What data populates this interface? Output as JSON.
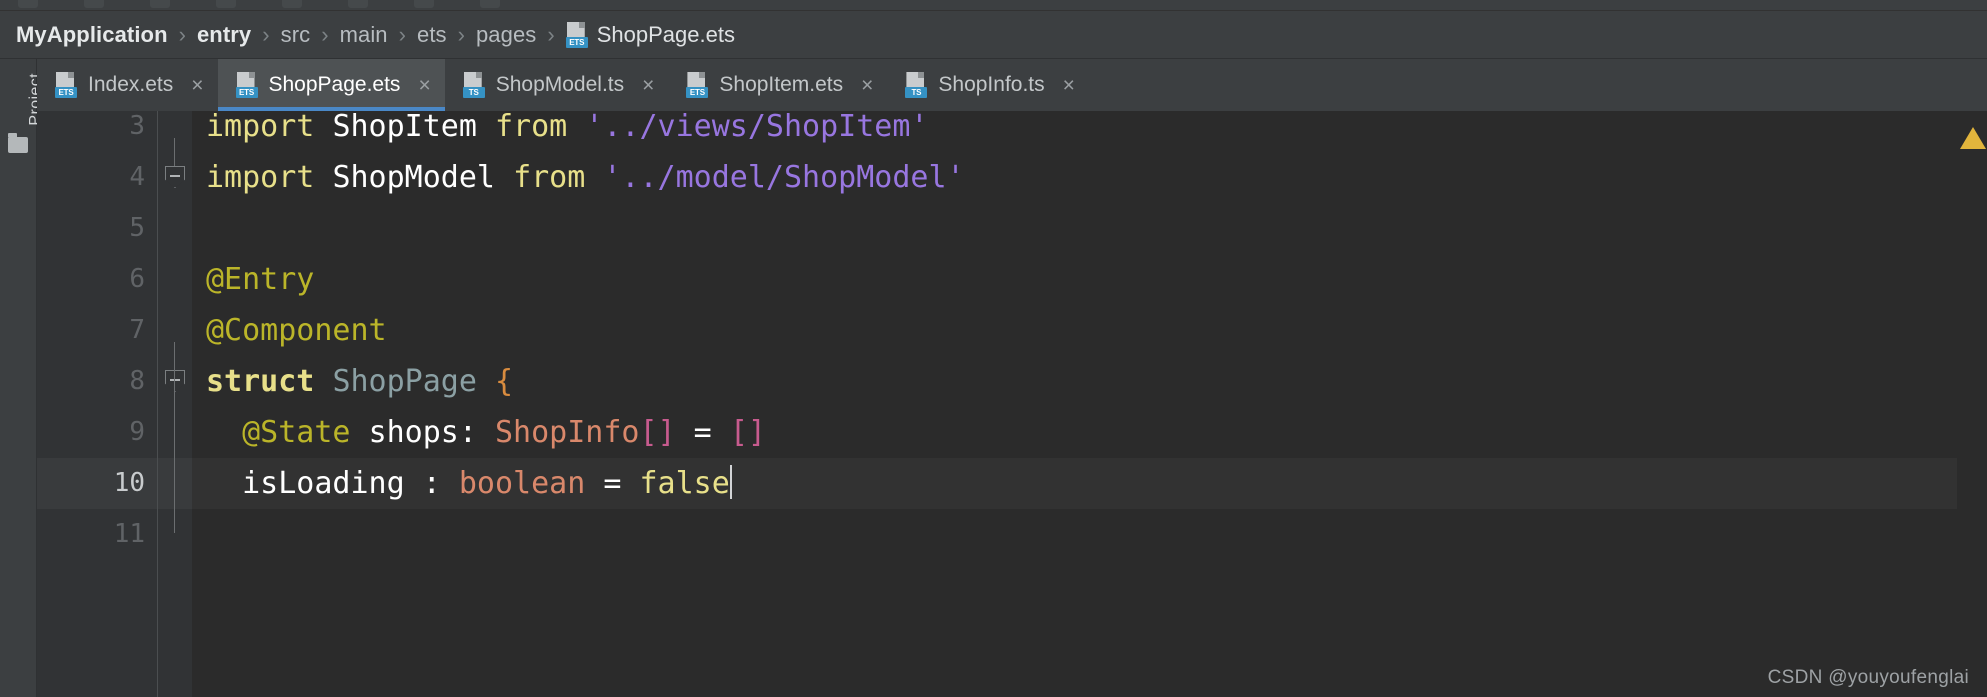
{
  "window": {
    "left_strip_label": "Project",
    "folder_icon": "folder-icon"
  },
  "breadcrumb": {
    "separator": "›",
    "items": [
      {
        "label": "MyApplication",
        "strong": true
      },
      {
        "label": "entry",
        "strong": true
      },
      {
        "label": "src",
        "strong": false
      },
      {
        "label": "main",
        "strong": false
      },
      {
        "label": "ets",
        "strong": false
      },
      {
        "label": "pages",
        "strong": false
      }
    ],
    "file": {
      "label": "ShopPage.ets",
      "icon": "ets-file-icon",
      "badge": "ETS"
    }
  },
  "tabs": [
    {
      "label": "Index.ets",
      "badge": "ETS",
      "active": false,
      "close": "×"
    },
    {
      "label": "ShopPage.ets",
      "badge": "ETS",
      "active": true,
      "close": "×"
    },
    {
      "label": "ShopModel.ts",
      "badge": "TS",
      "active": false,
      "close": "×"
    },
    {
      "label": "ShopItem.ets",
      "badge": "ETS",
      "active": false,
      "close": "×"
    },
    {
      "label": "ShopInfo.ts",
      "badge": "TS",
      "active": false,
      "close": "×"
    }
  ],
  "editor": {
    "current_line": 10,
    "line_numbers": [
      "3",
      "4",
      "5",
      "6",
      "7",
      "8",
      "9",
      "10",
      "11"
    ],
    "lines": [
      {
        "number": "3",
        "fold": false,
        "tokens": [
          {
            "text": "import ",
            "cls": "t-import"
          },
          {
            "text": "ShopItem ",
            "cls": "t-plain"
          },
          {
            "text": "from ",
            "cls": "t-import"
          },
          {
            "text": "'../views/ShopItem'",
            "cls": "t-str"
          }
        ]
      },
      {
        "number": "4",
        "fold": true,
        "tokens": [
          {
            "text": "import ",
            "cls": "t-import"
          },
          {
            "text": "ShopModel ",
            "cls": "t-plain"
          },
          {
            "text": "from ",
            "cls": "t-import"
          },
          {
            "text": "'../model/ShopModel'",
            "cls": "t-str"
          }
        ]
      },
      {
        "number": "5",
        "fold": false,
        "tokens": []
      },
      {
        "number": "6",
        "fold": false,
        "tokens": [
          {
            "text": "@Entry",
            "cls": "t-anno"
          }
        ]
      },
      {
        "number": "7",
        "fold": false,
        "tokens": [
          {
            "text": "@Component",
            "cls": "t-anno"
          }
        ]
      },
      {
        "number": "8",
        "fold": true,
        "tokens": [
          {
            "text": "struct ",
            "cls": "t-struct"
          },
          {
            "text": "ShopPage ",
            "cls": "t-type"
          },
          {
            "text": "{",
            "cls": "t-brace"
          }
        ]
      },
      {
        "number": "9",
        "fold": false,
        "tokens": [
          {
            "text": "  @State ",
            "cls": "t-anno"
          },
          {
            "text": "shops: ",
            "cls": "t-plain"
          },
          {
            "text": "ShopInfo",
            "cls": "t-cls"
          },
          {
            "text": "[]",
            "cls": "t-brack"
          },
          {
            "text": " = ",
            "cls": "t-plain"
          },
          {
            "text": "[]",
            "cls": "t-brack"
          }
        ]
      },
      {
        "number": "10",
        "fold": false,
        "tokens": [
          {
            "text": "  isLoading : ",
            "cls": "t-plain"
          },
          {
            "text": "boolean",
            "cls": "t-cls"
          },
          {
            "text": " = ",
            "cls": "t-plain"
          },
          {
            "text": "false",
            "cls": "t-bool"
          }
        ]
      },
      {
        "number": "11",
        "fold": false,
        "tokens": []
      }
    ],
    "markers": {
      "warning": "warning-triangle-icon"
    }
  },
  "watermark": "CSDN @youyoufenglai",
  "colors": {
    "tab_active_underline": "#4a88c7",
    "editor_bg": "#2b2b2b",
    "gutter_bg": "#313335",
    "chrome_bg": "#3c3f41",
    "current_line_bg": "#323232",
    "warning": "#e2b53c",
    "string": "#9876e0",
    "keyword": "#e8e08a",
    "annotation": "#bbb529",
    "class": "#d9886b",
    "bracket": "#c75b8e"
  }
}
